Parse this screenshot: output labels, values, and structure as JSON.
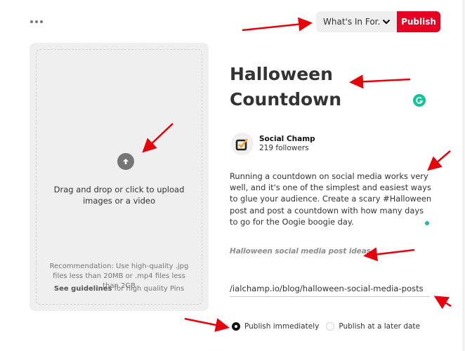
{
  "header": {
    "more_icon": "more-horizontal-icon",
    "board_select": {
      "selected": "What's In For...",
      "icon": "chevron-down-icon"
    },
    "publish_label": "Publish"
  },
  "upload": {
    "icon": "upload-arrow-icon",
    "prompt": "Drag and drop or click to upload images or a video",
    "recommendation": "Recommendation: Use high-quality .jpg files less than 20MB or .mp4 files less than 2GB",
    "guidelines_link": "See guidelines",
    "guidelines_suffix": " for high quality Pins"
  },
  "pin": {
    "title": "Halloween Countdown",
    "grammarly_icon": "grammarly-icon",
    "profile": {
      "name": "Social Champ",
      "followers": "219 followers",
      "avatar_icon": "checkbox-logo-icon"
    },
    "description": "Running a countdown on social media works very well, and it's one of the simplest and easiest ways to glue your audience. Create a scary #Halloween post and post a countdown with how many days to go for the Oogie boogie day.",
    "alt_text": "Halloween social media post ideas",
    "destination_link": "ialchamp.io/blog/halloween-social-media-posts/"
  },
  "publish_options": [
    {
      "label": "Publish immediately",
      "selected": true
    },
    {
      "label": "Publish at a later date",
      "selected": false
    }
  ],
  "annotation_color": "#e8000b"
}
